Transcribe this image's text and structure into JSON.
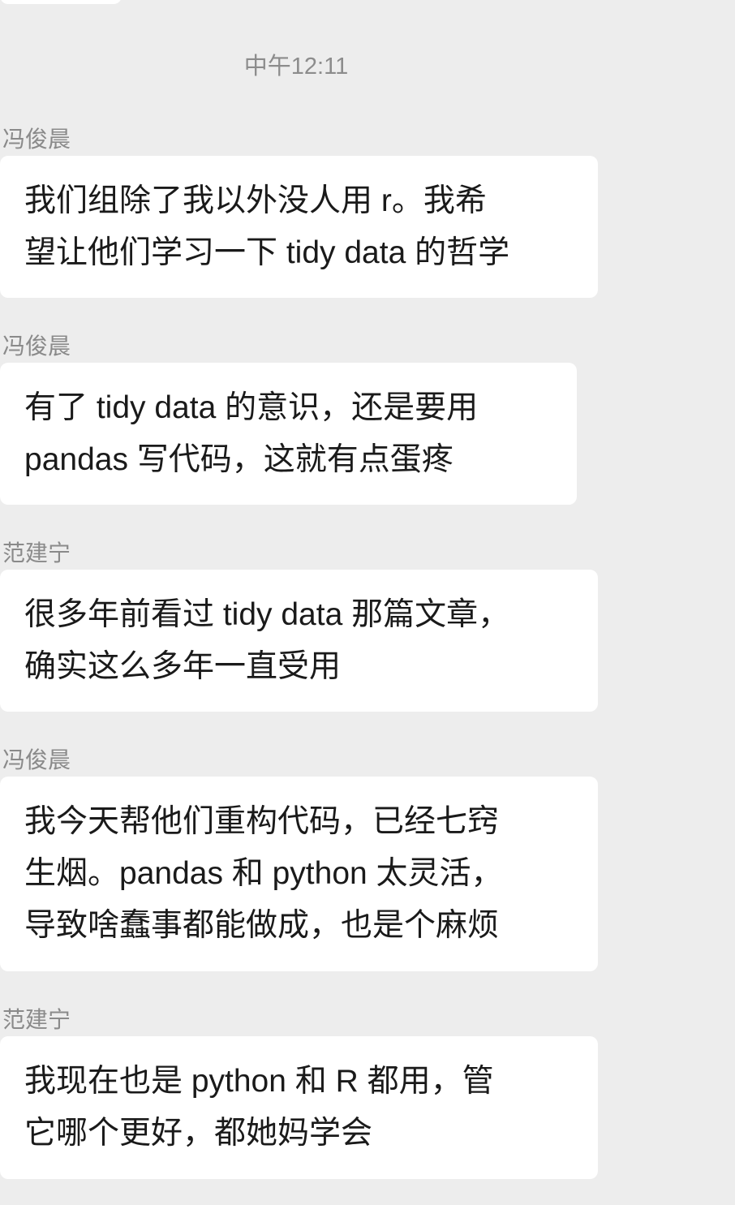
{
  "timestamp": "中午12:11",
  "messages": [
    {
      "sender": "冯俊晨",
      "lines": [
        "我们组除了我以外没人用 r。我希",
        "望让他们学习一下 tidy data 的哲学"
      ]
    },
    {
      "sender": "冯俊晨",
      "lines": [
        "有了 tidy data 的意识，还是要用",
        "pandas 写代码，这就有点蛋疼"
      ]
    },
    {
      "sender": "范建宁",
      "lines": [
        "很多年前看过 tidy data 那篇文章，",
        "确实这么多年一直受用"
      ]
    },
    {
      "sender": "冯俊晨",
      "lines": [
        "我今天帮他们重构代码，已经七窍",
        "生烟。pandas 和 python 太灵活，",
        "导致啥蠢事都能做成，也是个麻烦"
      ]
    },
    {
      "sender": "范建宁",
      "lines": [
        "我现在也是 python 和 R 都用，管",
        "它哪个更好，都她妈学会"
      ]
    }
  ]
}
